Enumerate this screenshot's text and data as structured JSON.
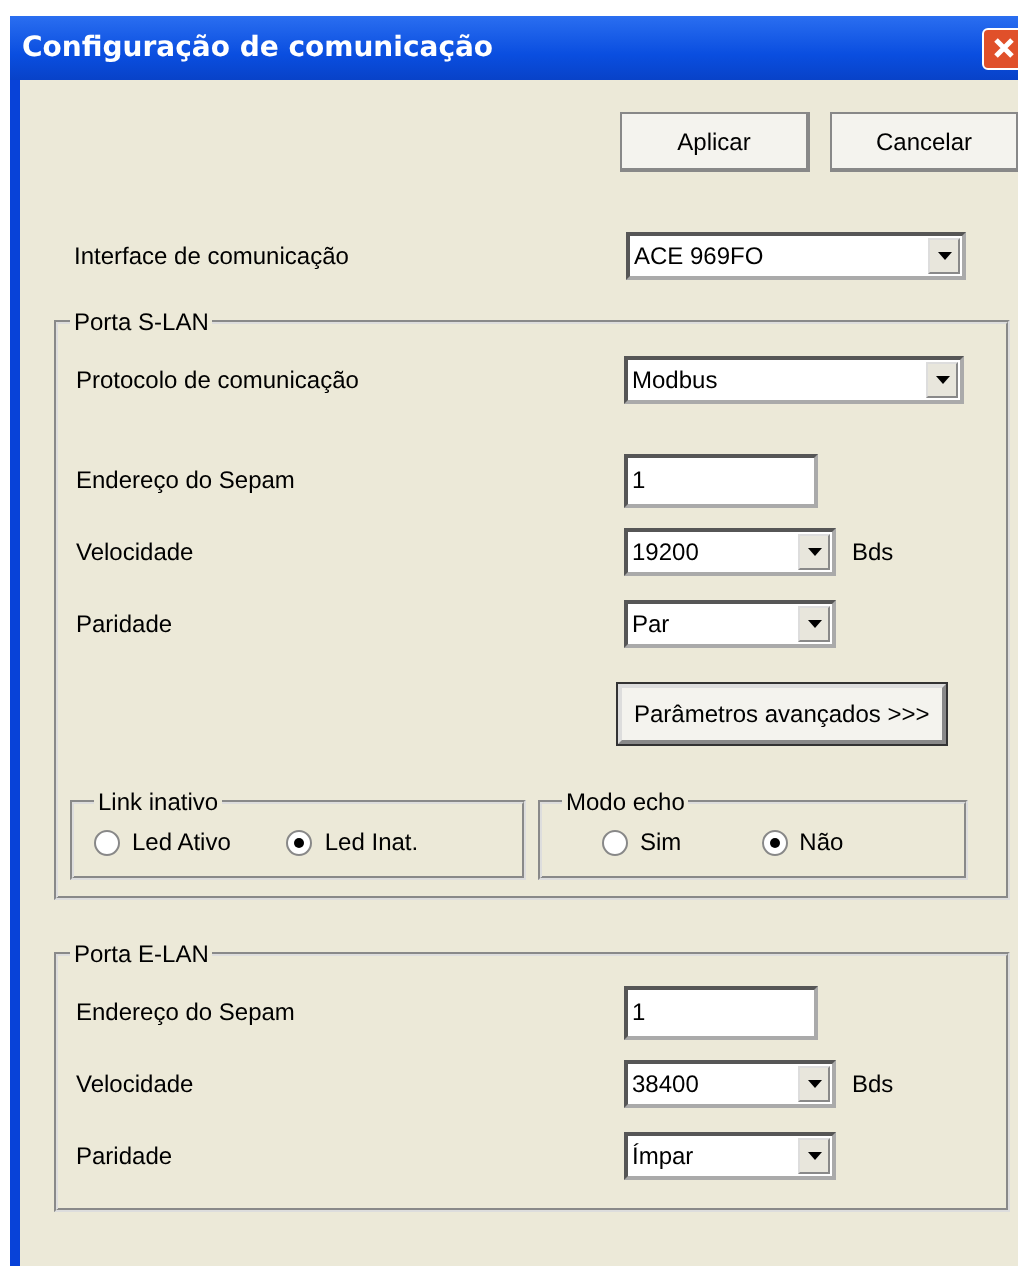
{
  "window": {
    "title": "Configuração de comunicação"
  },
  "buttons": [
    {
      "label": "Aplicar"
    },
    {
      "label": "Cancelar"
    }
  ],
  "interface": {
    "label": "Interface de comunicação",
    "value": "ACE 969FO"
  },
  "s_lan": {
    "title": "Porta S-LAN",
    "rows": [
      {
        "kind": "wide-select",
        "label": "Protocolo de comunicação",
        "value": "Modbus"
      },
      {
        "kind": "input",
        "label": "Endereço do Sepam",
        "value": "1"
      },
      {
        "kind": "select",
        "label": "Velocidade",
        "value": "19200",
        "unit": "Bds"
      },
      {
        "kind": "select",
        "label": "Paridade",
        "value": "Par"
      }
    ],
    "advanced_button": "Parâmetros avançados >>>",
    "groups": [
      {
        "title": "Link inativo",
        "options": [
          {
            "label": "Led Ativo",
            "selected": false
          },
          {
            "label": "Led Inat.",
            "selected": true
          }
        ]
      },
      {
        "title": "Modo echo",
        "options": [
          {
            "label": "Sim",
            "selected": false
          },
          {
            "label": "Não",
            "selected": true
          }
        ]
      }
    ]
  },
  "e_lan": {
    "title": "Porta E-LAN",
    "rows": [
      {
        "kind": "input",
        "label": "Endereço do Sepam",
        "value": "1"
      },
      {
        "kind": "select",
        "label": "Velocidade",
        "value": "38400",
        "unit": "Bds"
      },
      {
        "kind": "select",
        "label": "Paridade",
        "value": "Ímpar"
      }
    ]
  }
}
